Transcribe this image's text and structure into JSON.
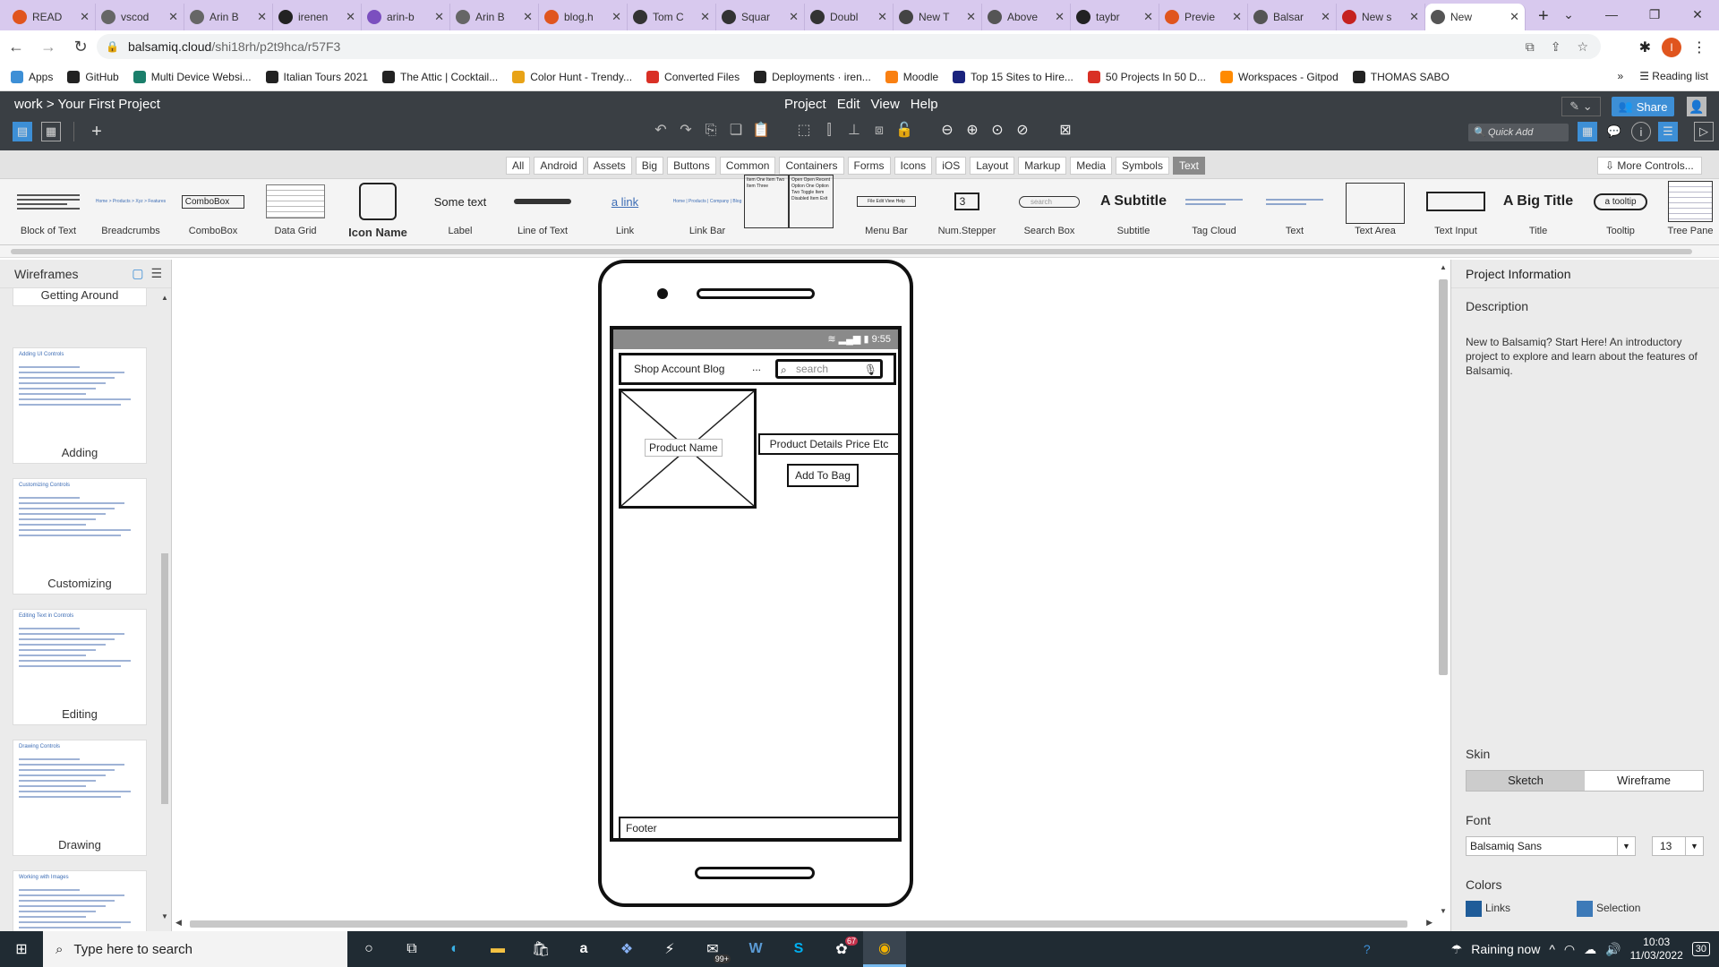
{
  "browser": {
    "tabs": [
      {
        "label": "READ",
        "color": "#e0551e"
      },
      {
        "label": "vscod",
        "color": "#666666"
      },
      {
        "label": "Arin B",
        "color": "#666666"
      },
      {
        "label": "irenen",
        "color": "#222222"
      },
      {
        "label": "arin-b",
        "color": "#7b4fbf"
      },
      {
        "label": "Arin B",
        "color": "#666666"
      },
      {
        "label": "blog.h",
        "color": "#e0551e"
      },
      {
        "label": "Tom C",
        "color": "#333333"
      },
      {
        "label": "Squar",
        "color": "#333333"
      },
      {
        "label": "Doubl",
        "color": "#333333"
      },
      {
        "label": "New T",
        "color": "#444444"
      },
      {
        "label": "Above",
        "color": "#555555"
      },
      {
        "label": "taybr",
        "color": "#222222"
      },
      {
        "label": "Previe",
        "color": "#e0551e"
      },
      {
        "label": "Balsar",
        "color": "#555555"
      },
      {
        "label": "New s",
        "color": "#c5221f"
      },
      {
        "label": "New",
        "color": "#555555"
      }
    ],
    "url_host": "balsamiq.cloud",
    "url_path": "/shi18rh/p2t9hca/r57F3",
    "profile_initial": "I",
    "bookmarks": [
      {
        "label": "Apps",
        "color": "#3d8fd6"
      },
      {
        "label": "GitHub",
        "color": "#222222"
      },
      {
        "label": "Multi Device Websi...",
        "color": "#1b7f6b"
      },
      {
        "label": "Italian Tours 2021",
        "color": "#222222"
      },
      {
        "label": "The Attic | Cocktail...",
        "color": "#222222"
      },
      {
        "label": "Color Hunt - Trendy...",
        "color": "#e8a317"
      },
      {
        "label": "Converted Files",
        "color": "#d93025"
      },
      {
        "label": "Deployments · iren...",
        "color": "#222222"
      },
      {
        "label": "Moodle",
        "color": "#f98012"
      },
      {
        "label": "Top 15 Sites to Hire...",
        "color": "#1a237e"
      },
      {
        "label": "50 Projects In 50 D...",
        "color": "#d93025"
      },
      {
        "label": "Workspaces - Gitpod",
        "color": "#ff8a00"
      },
      {
        "label": "THOMAS SABO",
        "color": "#222222"
      }
    ],
    "bookmarks_more": "»",
    "reading_list": "Reading list"
  },
  "app": {
    "breadcrumb": "work > Your First Project",
    "menus": [
      "Project",
      "Edit",
      "View",
      "Help"
    ],
    "share_label": "Share",
    "quick_add_placeholder": "Quick Add",
    "categories": [
      "All",
      "Android",
      "Assets",
      "Big",
      "Buttons",
      "Common",
      "Containers",
      "Forms",
      "Icons",
      "iOS",
      "Layout",
      "Markup",
      "Media",
      "Symbols",
      "Text"
    ],
    "selected_category": "Text",
    "more_controls": "More Controls...",
    "library": [
      {
        "label": "Block of Text",
        "preview": ""
      },
      {
        "label": "Breadcrumbs",
        "preview": "Home > Products > Xyz > Features"
      },
      {
        "label": "ComboBox",
        "preview": "ComboBox"
      },
      {
        "label": "Data Grid",
        "preview": ""
      },
      {
        "label": "Icon Name",
        "preview": ""
      },
      {
        "label": "Label",
        "preview": "Some text"
      },
      {
        "label": "Line of Text",
        "preview": ""
      },
      {
        "label": "Link",
        "preview": "a link"
      },
      {
        "label": "Link Bar",
        "preview": "Home | Products | Company | Blog"
      },
      {
        "label": "",
        "preview": "Item One Item Two Item Three"
      },
      {
        "label": "",
        "preview": "Open Open Recent Option One Option Two Toggle Item Disabled Item Exit"
      },
      {
        "label": "Menu Bar",
        "preview": "File Edit View Help"
      },
      {
        "label": "Num.Stepper",
        "preview": "3"
      },
      {
        "label": "Search Box",
        "preview": "search"
      },
      {
        "label": "Subtitle",
        "preview": "A Subtitle"
      },
      {
        "label": "Tag Cloud",
        "preview": ""
      },
      {
        "label": "Text",
        "preview": ""
      },
      {
        "label": "Text Area",
        "preview": ""
      },
      {
        "label": "Text Input",
        "preview": ""
      },
      {
        "label": "Title",
        "preview": "A Big Title"
      },
      {
        "label": "Tooltip",
        "preview": "a tooltip"
      },
      {
        "label": "Tree Pane",
        "preview": ""
      }
    ],
    "wireframes_title": "Wireframes",
    "wireframes": [
      {
        "label": "Getting Around"
      },
      {
        "label": "Adding",
        "heading": "Adding UI Controls"
      },
      {
        "label": "Customizing",
        "heading": "Customizing Controls"
      },
      {
        "label": "Editing",
        "heading": "Editing Text in Controls"
      },
      {
        "label": "Drawing",
        "heading": "Drawing Controls"
      },
      {
        "label": "",
        "heading": "Working with Images"
      }
    ]
  },
  "mockup": {
    "status_time": "9:55",
    "nav_links": "Shop Account Blog",
    "nav_more": "...",
    "search_placeholder": "search",
    "product_name": "Product Name",
    "product_details": "Product Details Price Etc",
    "add_button": "Add To Bag",
    "footer": "Footer"
  },
  "inspector": {
    "title": "Project Information",
    "description_label": "Description",
    "description": "New to Balsamiq? Start Here! An introductory project to explore and learn about the features of Balsamiq.",
    "skin_label": "Skin",
    "skins": [
      "Sketch",
      "Wireframe"
    ],
    "selected_skin": "Sketch",
    "font_label": "Font",
    "font_value": "Balsamiq Sans",
    "font_size": "13",
    "colors_label": "Colors",
    "links_label": "Links",
    "links_color": "#1f5c99",
    "selection_label": "Selection",
    "selection_color": "#3d7ab8"
  },
  "taskbar": {
    "search_placeholder": "Type here to search",
    "mail_badge": "99+",
    "teams_badge": "67",
    "weather": "Raining now",
    "time": "10:03",
    "date": "11/03/2022",
    "notifications": "30"
  }
}
